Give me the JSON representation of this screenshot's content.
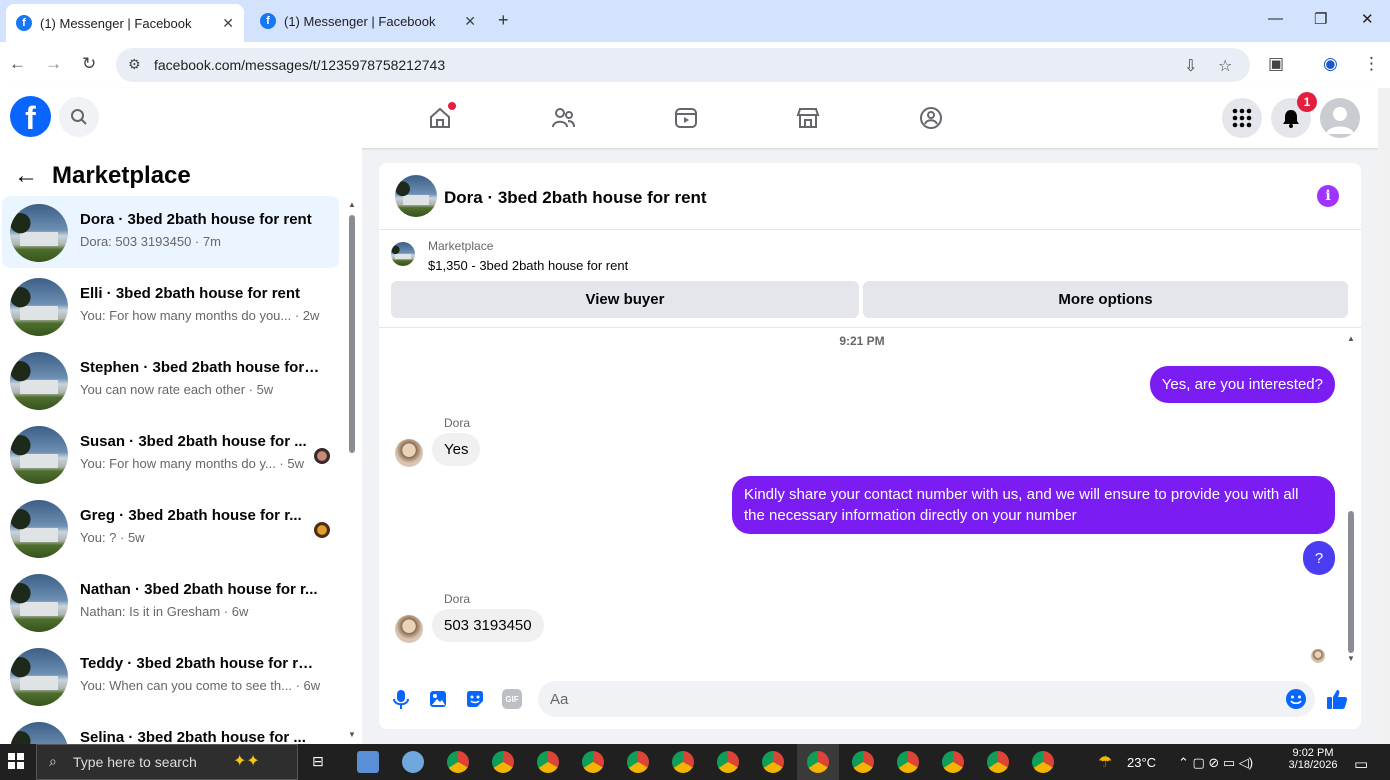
{
  "browser": {
    "tabs": [
      {
        "title": "(1) Messenger | Facebook",
        "close": "✕"
      },
      {
        "title": "(1) Messenger | Facebook",
        "close": "✕"
      }
    ],
    "new_tab": "+",
    "url": "facebook.com/messages/t/1235978758212743"
  },
  "fb": {
    "logo": "f",
    "notifications_count": "1"
  },
  "left": {
    "title": "Marketplace",
    "conversations": [
      {
        "title": "Dora · 3bed 2bath house for rent",
        "sub": "Dora: 503 3193450 · 7m"
      },
      {
        "title": "Elli · 3bed 2bath house for rent",
        "sub": "You: For how many months do you... · 2w"
      },
      {
        "title": "Stephen · 3bed 2bath house for ...",
        "sub": "You can now rate each other · 5w"
      },
      {
        "title": "Susan · 3bed 2bath house for ...",
        "sub": "You: For how many months do y... · 5w"
      },
      {
        "title": "Greg · 3bed 2bath house for r...",
        "sub": "You: ? · 5w"
      },
      {
        "title": "Nathan · 3bed 2bath house for r...",
        "sub": "Nathan: Is it in Gresham · 6w"
      },
      {
        "title": "Teddy · 3bed 2bath house for rent",
        "sub": "You: When can you come to see th... · 6w"
      },
      {
        "title": "Selina · 3bed 2bath house for ...",
        "sub": ""
      }
    ]
  },
  "chat": {
    "name": "Dora · 3bed 2bath house for rent",
    "marketplace_label": "Marketplace",
    "listing": "$1,350 - 3bed 2bath house for rent",
    "view_buyer": "View buyer",
    "more_options": "More options",
    "timestamp": "9:21 PM",
    "messages": [
      {
        "from": "me",
        "text": "Yes, are you interested?"
      },
      {
        "from": "Dora",
        "sender": "Dora",
        "text": "Yes"
      },
      {
        "from": "me",
        "text": "Kindly share your contact number with us, and we will ensure to provide you with all the necessary information directly on your number"
      },
      {
        "from": "me",
        "text": "?"
      },
      {
        "from": "Dora",
        "sender": "Dora",
        "text": "503 3193450"
      }
    ],
    "composer_placeholder": "Aa"
  },
  "taskbar": {
    "search_placeholder": "Type here to search",
    "temperature": "23°C",
    "time": "9:02 PM",
    "date": "3/18/2026"
  },
  "colors": {
    "accent": "#7a1cf2",
    "fb_blue": "#0866ff",
    "selected_row": "#ebf5ff"
  }
}
